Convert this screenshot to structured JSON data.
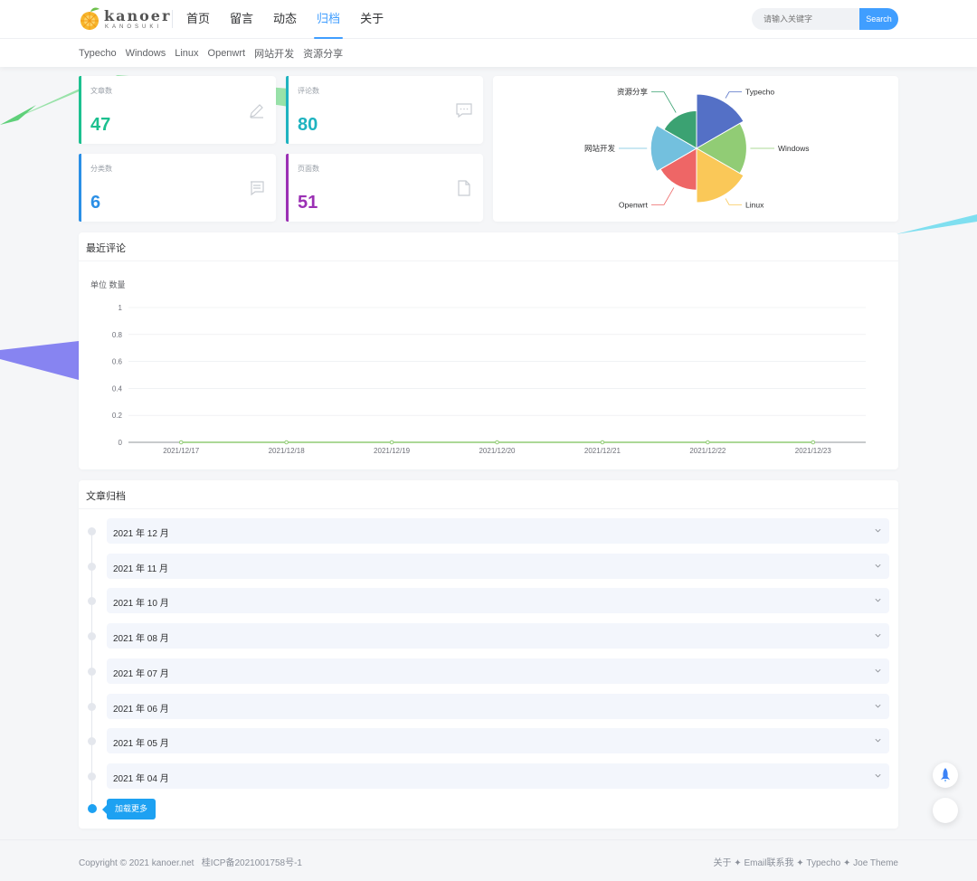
{
  "brand": {
    "logo_text": "kanoer",
    "logo_sub": "KANOSUKI"
  },
  "nav": {
    "items": [
      "首页",
      "留言",
      "动态",
      "归档",
      "关于"
    ],
    "active": "归档"
  },
  "search": {
    "placeholder": "请输入关键字",
    "button": "Search"
  },
  "subnav": {
    "items": [
      "Typecho",
      "Windows",
      "Linux",
      "Openwrt",
      "网站开发",
      "资源分享"
    ]
  },
  "stats": [
    {
      "label": "文章数",
      "value": "47",
      "color": "#1cc08f",
      "icon": "pencil-icon"
    },
    {
      "label": "评论数",
      "value": "80",
      "color": "#1fb3c0",
      "icon": "comment-icon"
    },
    {
      "label": "分类数",
      "value": "6",
      "color": "#2b8fe6",
      "icon": "list-icon"
    },
    {
      "label": "页面数",
      "value": "51",
      "color": "#9b30b4",
      "icon": "file-icon"
    }
  ],
  "pie": {
    "chart_data": {
      "type": "pie",
      "rose": true,
      "categories": [
        "Typecho",
        "Windows",
        "Linux",
        "Openwrt",
        "网站开发",
        "资源分享"
      ],
      "values": [
        10,
        9,
        10,
        7,
        8,
        6
      ],
      "colors": [
        "#5470c6",
        "#91cc75",
        "#fac858",
        "#ee6666",
        "#73c0de",
        "#3ba272"
      ]
    }
  },
  "comments": {
    "title": "最近评论",
    "unit": "单位 数量",
    "chart_data": {
      "type": "line",
      "x": [
        "2021/12/17",
        "2021/12/18",
        "2021/12/19",
        "2021/12/20",
        "2021/12/21",
        "2021/12/22",
        "2021/12/23"
      ],
      "values": [
        0,
        0,
        0,
        0,
        0,
        0,
        0
      ],
      "ylim": [
        0,
        1
      ],
      "yticks": [
        "0",
        "0.2",
        "0.4",
        "0.6",
        "0.8",
        "1"
      ],
      "grid": true,
      "color": "#91cc75"
    }
  },
  "archive": {
    "title": "文章归档",
    "months": [
      "2021 年 12 月",
      "2021 年 11 月",
      "2021 年 10 月",
      "2021 年 08 月",
      "2021 年 07 月",
      "2021 年 06 月",
      "2021 年 05 月",
      "2021 年 04 月"
    ],
    "load_more": "加载更多"
  },
  "footer": {
    "left": "Copyright © 2021 kanoer.net   桂ICP备2021001758号-1",
    "right": "关于 ✦ Email联系我 ✦ Typecho ✦ Joe Theme"
  },
  "fab": {
    "icon": "rocket-icon"
  }
}
